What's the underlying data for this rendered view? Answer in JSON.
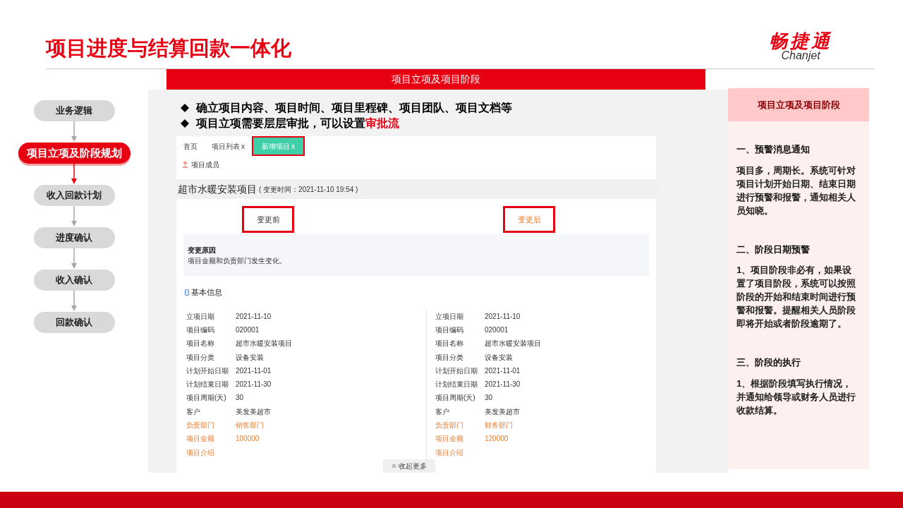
{
  "title": "项目进度与结算回款一体化",
  "logo": {
    "name": "畅捷通",
    "latin": "Chanjet"
  },
  "flow": [
    {
      "label": "业务逻辑",
      "selected": false
    },
    {
      "label": "项目立项及阶段规划",
      "selected": true
    },
    {
      "label": "收入回款计划",
      "selected": false
    },
    {
      "label": "进度确认",
      "selected": false
    },
    {
      "label": "收入确认",
      "selected": false
    },
    {
      "label": "回款确认",
      "selected": false
    }
  ],
  "banner": "项目立项及项目阶段",
  "bullets": [
    "确立项目内容、项目时间、项目里程碑、项目团队、项目文档等",
    "项目立项需要层层审批，可以设置**审批流**"
  ],
  "app": {
    "tabs": [
      {
        "label": "首页",
        "selected": false
      },
      {
        "label": "项目列表",
        "close_mark": "x",
        "selected": false
      },
      {
        "label": "新增项目",
        "close_mark": "x",
        "selected": true
      }
    ],
    "members_label": "项目成员",
    "record_title": "超市水暖安装项目",
    "record_time": "( 变更时间：2021-11-10 19:54 )",
    "before_label": "变更前",
    "after_label": "变更后",
    "reason_title": "变更原因",
    "reason_text": "项目金额和负责部门发生变化。",
    "section_title": "基本信息",
    "columns": [
      [
        {
          "label": "立项日期",
          "value": "2021-11-10",
          "changed": false
        },
        {
          "label": "项目编码",
          "value": "020001",
          "changed": false
        },
        {
          "label": "项目名称",
          "value": "超市水暖安装项目",
          "changed": false
        },
        {
          "label": "项目分类",
          "value": "设备安装",
          "changed": false
        },
        {
          "label": "计划开始日期",
          "value": "2021-11-01",
          "changed": false
        },
        {
          "label": "计划结束日期",
          "value": "2021-11-30",
          "changed": false
        },
        {
          "label": "项目周期(天)",
          "value": "30",
          "changed": false
        },
        {
          "label": "客户",
          "value": "美发美超市",
          "changed": false
        },
        {
          "label": "负责部门",
          "value": "销售部门",
          "changed": true
        },
        {
          "label": "项目金额",
          "value": "100000",
          "changed": true
        },
        {
          "label": "项目介绍",
          "changed": true
        }
      ],
      [
        {
          "label": "立项日期",
          "value": "2021-11-10",
          "changed": false
        },
        {
          "label": "项目编码",
          "value": "020001",
          "changed": false
        },
        {
          "label": "项目名称",
          "value": "超市水暖安装项目",
          "changed": false
        },
        {
          "label": "项目分类",
          "value": "设备安装",
          "changed": false
        },
        {
          "label": "计划开始日期",
          "value": "2021-11-01",
          "changed": false
        },
        {
          "label": "计划结束日期",
          "value": "2021-11-30",
          "changed": false
        },
        {
          "label": "项目周期(天)",
          "value": "30",
          "changed": false
        },
        {
          "label": "客户",
          "value": "美发美超市",
          "changed": false
        },
        {
          "label": "负责部门",
          "value": "财务部门",
          "changed": true
        },
        {
          "label": "项目金额",
          "value": "120000",
          "changed": true
        },
        {
          "label": "项目介绍",
          "changed": true
        }
      ]
    ],
    "collapse_label": "收起更多"
  },
  "side_panel": {
    "title": "项目立项及项目阶段",
    "sections": [
      {
        "heading": "一、预警消息通知",
        "text": "项目多，周期长。系统可针对项目计划开始日期、结束日期进行预警和报警，通知相关人员知晓。"
      },
      {
        "heading": "二、阶段日期预警",
        "text": "1、项目阶段非必有，如果设置了项目阶段，系统可以按照阶段的开始和结束时间进行预警和报警。提醒相关人员阶段即将开始或者阶段逾期了。"
      },
      {
        "heading": "三、阶段的执行",
        "text": "1、根据阶段填写执行情况，并通知给领导或财务人员进行收款结算。"
      }
    ]
  }
}
